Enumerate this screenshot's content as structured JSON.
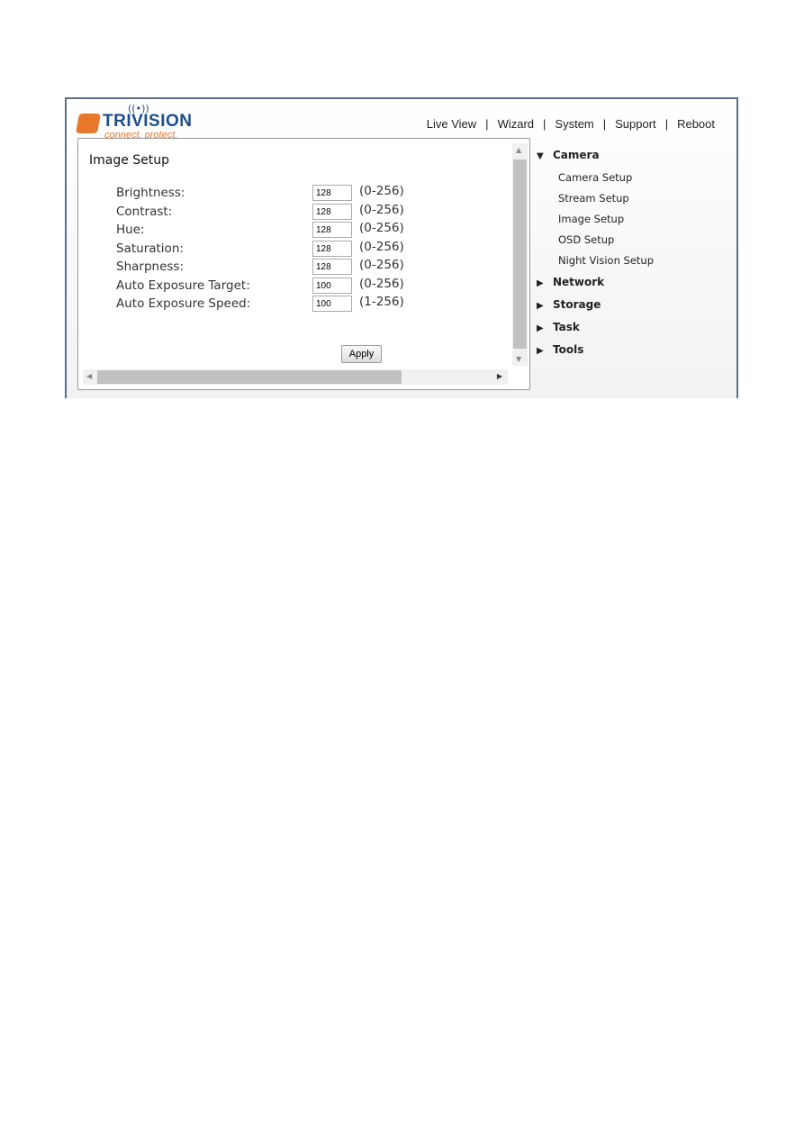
{
  "logo": {
    "name": "TRIVISION",
    "tagline": "connect. protect."
  },
  "topnav": [
    "Live View",
    "Wizard",
    "System",
    "Support",
    "Reboot"
  ],
  "panel": {
    "title": "Image Setup",
    "fields": [
      {
        "label": "Brightness:",
        "value": "128",
        "range": "(0-256)"
      },
      {
        "label": "Contrast:",
        "value": "128",
        "range": "(0-256)"
      },
      {
        "label": "Hue:",
        "value": "128",
        "range": "(0-256)"
      },
      {
        "label": "Saturation:",
        "value": "128",
        "range": "(0-256)"
      },
      {
        "label": "Sharpness:",
        "value": "128",
        "range": "(0-256)"
      },
      {
        "label": "Auto Exposure Target:",
        "value": "100",
        "range": "(0-256)"
      },
      {
        "label": "Auto Exposure Speed:",
        "value": "100",
        "range": "(1-256)"
      }
    ],
    "apply": "Apply"
  },
  "sidebar": {
    "camera": "Camera",
    "camera_items": [
      "Camera Setup",
      "Stream Setup",
      "Image Setup",
      "OSD Setup",
      "Night Vision Setup"
    ],
    "network": "Network",
    "storage": "Storage",
    "task": "Task",
    "tools": "Tools"
  }
}
